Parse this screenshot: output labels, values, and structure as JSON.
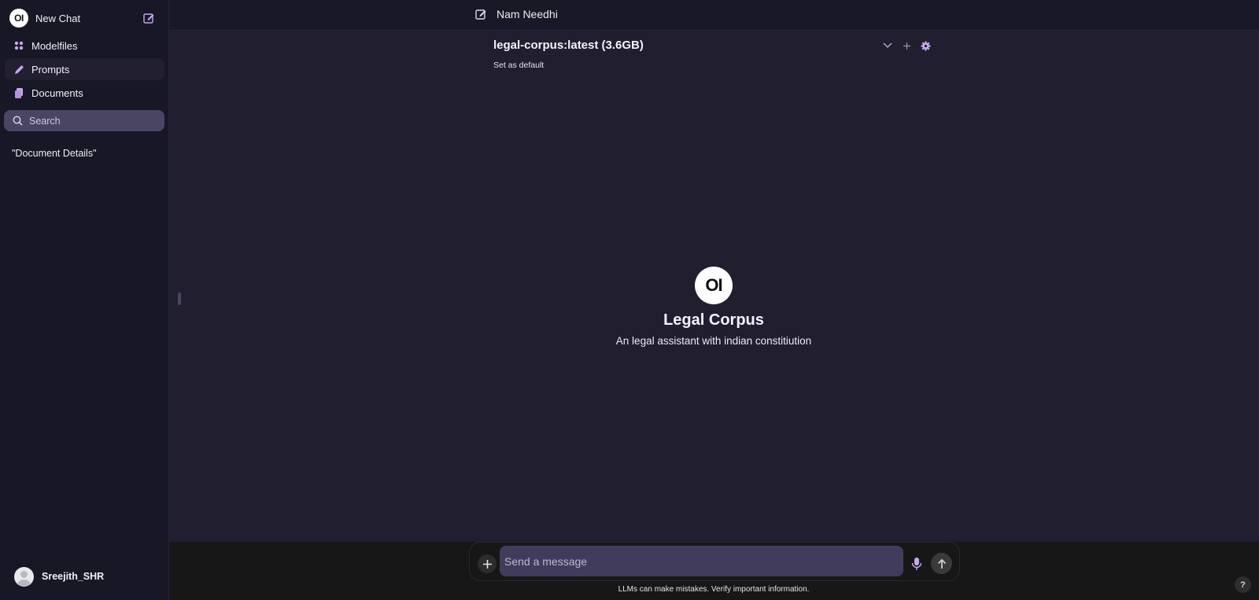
{
  "sidebar": {
    "new_chat_label": "New Chat",
    "logo_text": "OI",
    "items": [
      {
        "label": "Modelfiles",
        "icon": "grid-icon"
      },
      {
        "label": "Prompts",
        "icon": "pencil-icon"
      },
      {
        "label": "Documents",
        "icon": "documents-icon"
      }
    ],
    "search_placeholder": "Search",
    "chats": [
      {
        "title": "\"Document Details\""
      }
    ],
    "user_name": "Sreejith_SHR"
  },
  "topbar": {
    "title": "Nam Needhi"
  },
  "model": {
    "selected": "legal-corpus:latest (3.6GB)",
    "set_default_label": "Set as default",
    "logo_text": "OI",
    "name": "Legal Corpus",
    "description": "An legal assistant with indian constitiution"
  },
  "composer": {
    "placeholder": "Send a message",
    "disclaimer": "LLMs can make mistakes. Verify important information."
  },
  "help_label": "?",
  "colors": {
    "accent_icon": "#c9a7ef",
    "sidebar_bg": "#181726",
    "main_bg": "#201e2f",
    "input_bg": "#413b5c"
  }
}
